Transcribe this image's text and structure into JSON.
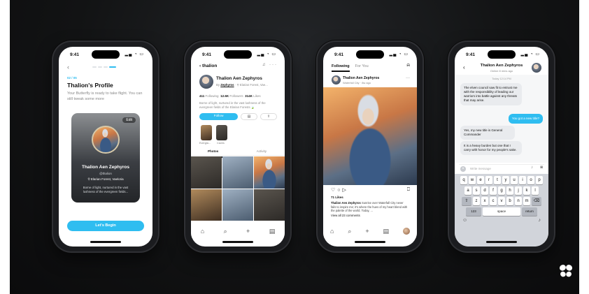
{
  "status_time": "9:41",
  "status_icons": "signal wifi battery",
  "accent_color": "#2fbdf0",
  "brand_logo": "butterfly-icon",
  "phone1": {
    "step": "02 / 05",
    "title": "Thalion's Profile",
    "subtitle": "Your Butterfly is ready to take flight. You can still tweak some more",
    "edit_label": "Edit",
    "card_name": "Thalion Aen Zephyros",
    "card_handle": "@thalion",
    "card_location": "Elarian Forest, Vaeloria",
    "card_bio": "Borne of light, nurtured in the vast lushness of the evergreen fields...",
    "button": "Let's Begin"
  },
  "phone2": {
    "header": "thalion",
    "name": "Thalion Aen Zephyros",
    "by_prefix": "By",
    "by_name": "Zephyros",
    "location": "Elarian Forest, Vae...",
    "following_count": "411",
    "following_label": "Following",
    "followers_count": "12.6K",
    "followers_label": "Followers",
    "likes_count": "314K",
    "likes_label": "Likes",
    "bio": "Borne of light, nurtured in the vast lushness of the evergreen fields of the Elarian Forests",
    "follow_button": "Follow",
    "highlights": [
      "Evergla...",
      "Caves"
    ],
    "tab_photos": "Photos",
    "tab_activity": "Activity"
  },
  "phone3": {
    "tab_following": "Following",
    "tab_foryou": "For You",
    "post_name": "Thalion Aen Zephyros",
    "post_meta": "Waterfall City · 8w ago",
    "likes": "71 Likes",
    "caption_name": "Thalion Aen Zephyros",
    "caption": "Sunrise over Waterfall City never fails to inspire me; it's where the hues of my heart blend with the palette of the world. Today, ...",
    "view_comments": "View all 23 comments"
  },
  "phone4": {
    "contact_name": "Thalion Aen Zephyros",
    "contact_status": "Online 8 mins ago",
    "timestamp": "Today 12:14 PM",
    "messages": [
      {
        "from": "them",
        "text": "The elven council saw fit to entrust me with the responsibility of leading our warriors into battle against any threats that may arise."
      },
      {
        "from": "me",
        "text": "You got a new title?"
      },
      {
        "from": "them",
        "text": "Yes, my new title is General Commander"
      },
      {
        "from": "them",
        "text": "It is a heavy burden but one that I carry with honor for my people's sake."
      }
    ],
    "input_placeholder": "Write message",
    "keyboard": {
      "row1": [
        "q",
        "w",
        "e",
        "r",
        "t",
        "y",
        "u",
        "i",
        "o",
        "p"
      ],
      "row2": [
        "a",
        "s",
        "d",
        "f",
        "g",
        "h",
        "j",
        "k",
        "l"
      ],
      "row3": [
        "z",
        "x",
        "c",
        "v",
        "b",
        "n",
        "m"
      ],
      "numbers_key": "123",
      "space_key": "space",
      "return_key": "return"
    }
  }
}
